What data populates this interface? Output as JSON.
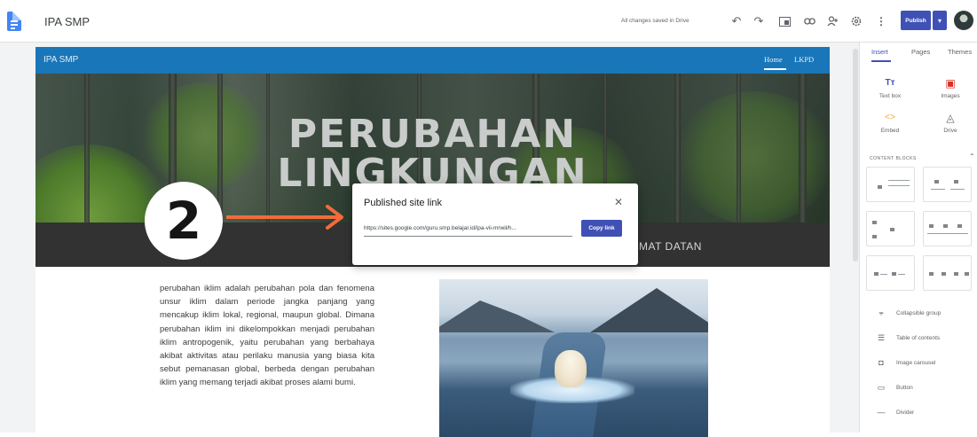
{
  "app": {
    "title": "IPA SMP",
    "save_status": "All changes saved in Drive",
    "publish_label": "Publish",
    "icons": [
      "undo-icon",
      "redo-icon",
      "preview-icon",
      "link-icon",
      "share-icon",
      "settings-icon",
      "more-icon"
    ]
  },
  "site": {
    "nav_title": "IPA SMP",
    "nav_links": [
      "Home",
      "LKPD"
    ],
    "hero_title_line1": "PERUBAHAN",
    "hero_title_line2": "LINGKUNGAN",
    "strip_text": "MAT DATAN",
    "body_text": "perubahan iklim adalah perubahan pola dan fenomena unsur iklim dalam periode jangka panjang yang mencakup iklim lokal, regional, maupun global. Dimana perubahan iklim ini dikelompokkan menjadi perubahan iklim antropogenik, yaitu perubahan yang berbahaya akibat aktivitas atau perilaku manusia yang biasa kita sebut pemanasan global, berbeda dengan perubahan iklim yang memang terjadi akibat proses alami bumi."
  },
  "annotation": {
    "step_number": "2",
    "arrow_color": "#f26b3a"
  },
  "dialog": {
    "title": "Published site link",
    "url": "https://sites.google.com/guru.smp.belajar.id/ipa-vii-mrwil/h...",
    "copy_label": "Copy link"
  },
  "panel": {
    "tabs": [
      "Insert",
      "Pages",
      "Themes"
    ],
    "tools": [
      {
        "label": "Text box",
        "icon": "text-box-icon"
      },
      {
        "label": "Images",
        "icon": "image-icon"
      },
      {
        "label": "Embed",
        "icon": "embed-icon"
      },
      {
        "label": "Drive",
        "icon": "drive-icon"
      }
    ],
    "content_blocks_label": "CONTENT BLOCKS",
    "items": [
      {
        "label": "Collapsible group",
        "icon": "collapsible-icon"
      },
      {
        "label": "Table of contents",
        "icon": "toc-icon"
      },
      {
        "label": "Image carousel",
        "icon": "carousel-icon"
      },
      {
        "label": "Button",
        "icon": "button-icon"
      },
      {
        "label": "Divider",
        "icon": "divider-icon"
      }
    ]
  },
  "colors": {
    "accent": "#3f51b5",
    "nav_bar": "#1976b8",
    "strip": "#323232"
  }
}
